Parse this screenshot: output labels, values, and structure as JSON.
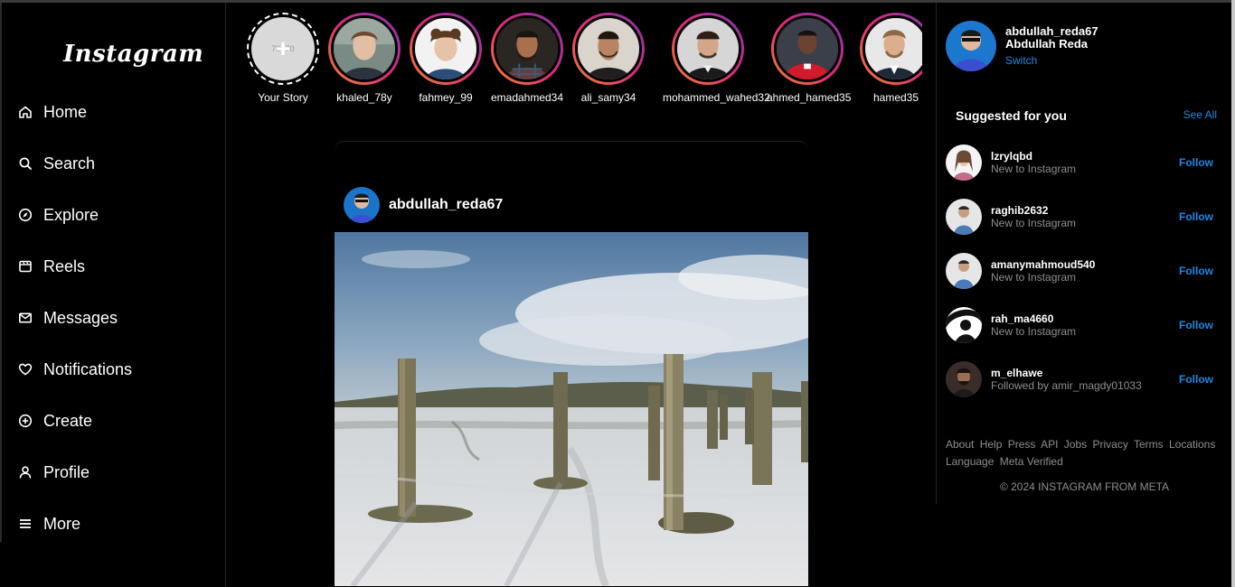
{
  "sidebar": {
    "logo": "Instagram",
    "items": [
      {
        "label": "Home",
        "icon": "home-icon"
      },
      {
        "label": "Search",
        "icon": "search-icon"
      },
      {
        "label": "Explore",
        "icon": "compass-icon"
      },
      {
        "label": "Reels",
        "icon": "reels-icon"
      },
      {
        "label": "Messages",
        "icon": "mail-icon"
      },
      {
        "label": "Notifications",
        "icon": "heart-icon"
      },
      {
        "label": "Create",
        "icon": "plus-circle-icon"
      },
      {
        "label": "Profile",
        "icon": "user-icon"
      },
      {
        "label": "More",
        "icon": "menu-icon"
      }
    ]
  },
  "stories": {
    "yours": {
      "label": "Your Story",
      "placeholder": "70×70",
      "icon": "plus-icon"
    },
    "items": [
      {
        "name": "khaled_78y"
      },
      {
        "name": "fahmey_99"
      },
      {
        "name": "emadahmed34"
      },
      {
        "name": "ali_samy34"
      },
      {
        "name": "mohammed_wahed32"
      },
      {
        "name": "ahmed_hamed35"
      },
      {
        "name": "hamed35"
      }
    ]
  },
  "post": {
    "username": "abdullah_reda67"
  },
  "account": {
    "username": "abdullah_reda67",
    "full_name": "Abdullah Reda",
    "switch_label": "Switch"
  },
  "suggestions": {
    "title": "Suggested for you",
    "see_all": "See All",
    "items": [
      {
        "username": "lzrylqbd",
        "subtitle": "New to Instagram",
        "action": "Follow"
      },
      {
        "username": "raghib2632",
        "subtitle": "New to Instagram",
        "action": "Follow"
      },
      {
        "username": "amanymahmoud540",
        "subtitle": "New to Instagram",
        "action": "Follow"
      },
      {
        "username": "rah_ma4660",
        "subtitle": "New to Instagram",
        "action": "Follow"
      },
      {
        "username": "m_elhawe",
        "subtitle": "Followed by amir_magdy01033",
        "action": "Follow"
      }
    ]
  },
  "footer": {
    "links": [
      "About",
      "Help",
      "Press",
      "API",
      "Jobs",
      "Privacy",
      "Terms",
      "Locations",
      "Language",
      "Meta Verified"
    ],
    "copyright": "© 2024 INSTAGRAM FROM META"
  },
  "colors": {
    "background": "#000000",
    "link_blue": "#1e88e5",
    "muted": "#8e8e8e",
    "story_ring_start": "#f58529",
    "story_ring_end": "#8134af"
  }
}
